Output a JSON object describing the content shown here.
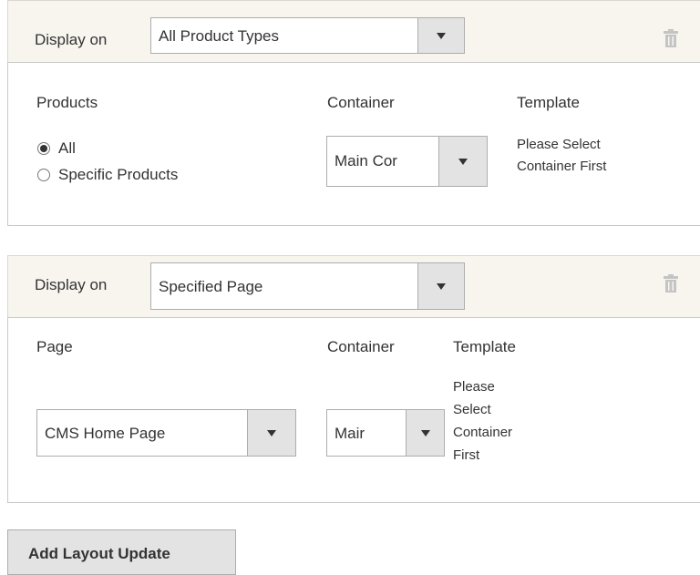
{
  "block1": {
    "display_label": "Display on",
    "display_value": "All Product Types",
    "col_products": "Products",
    "radio_all": "All",
    "radio_specific": "Specific Products",
    "col_container": "Container",
    "container_value": "Main Cor",
    "col_template": "Template",
    "template_line1": "Please Select",
    "template_line2": "Container First"
  },
  "block2": {
    "display_label": "Display on",
    "display_value": "Specified Page",
    "col_page": "Page",
    "page_value": "CMS Home Page",
    "col_container": "Container",
    "container_value": "Mair",
    "col_template": "Template",
    "template_line1": "Please",
    "template_line2": "Select",
    "template_line3": "Container",
    "template_line4": "First"
  },
  "add_button": "Add Layout Update",
  "icons": {
    "delete": "trash-icon",
    "dropdown": "chevron-down-icon"
  },
  "colors": {
    "header_bg": "#f8f5ef",
    "button_bg": "#e3e3e3",
    "border": "#adadad"
  }
}
